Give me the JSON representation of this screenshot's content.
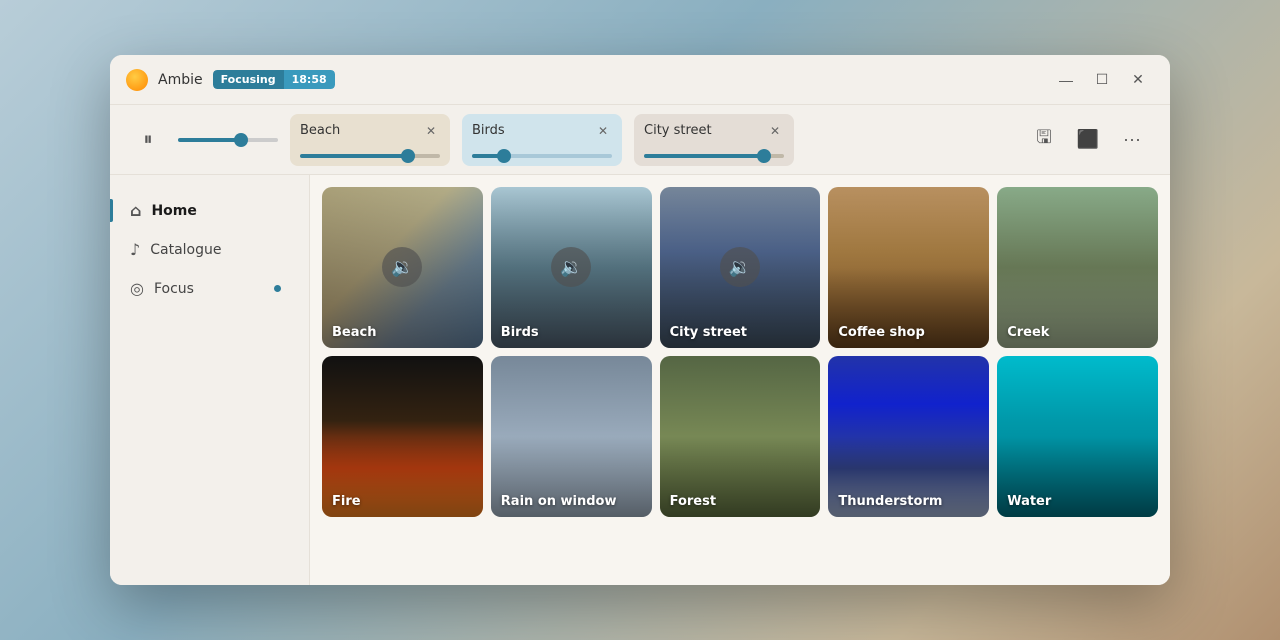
{
  "app": {
    "name": "Ambie",
    "badge_label": "Focusing",
    "badge_time": "18:58"
  },
  "window_controls": {
    "minimize": "—",
    "maximize": "☐",
    "close": "✕"
  },
  "toolbar": {
    "pause_icon": "⏸",
    "save_icon": "💾",
    "image_icon": "🖼",
    "more_icon": "···",
    "tracks": [
      {
        "name": "Beach",
        "value": 80,
        "theme": "beach"
      },
      {
        "name": "Birds",
        "value": 20,
        "theme": "birds"
      },
      {
        "name": "City street",
        "value": 90,
        "theme": "citystreet"
      }
    ]
  },
  "sidebar": {
    "items": [
      {
        "id": "home",
        "label": "Home",
        "icon": "⌂",
        "active": true
      },
      {
        "id": "catalogue",
        "label": "Catalogue",
        "icon": "♪",
        "active": false
      },
      {
        "id": "focus",
        "label": "Focus",
        "icon": "◎",
        "active": false,
        "dot": true
      }
    ]
  },
  "grid": {
    "row1": [
      {
        "id": "beach",
        "label": "Beach",
        "theme": "tile-beach",
        "active": true
      },
      {
        "id": "birds",
        "label": "Birds",
        "theme": "tile-birds",
        "active": true
      },
      {
        "id": "citystreet",
        "label": "City street",
        "theme": "tile-citystreet",
        "active": true
      },
      {
        "id": "coffeeshop",
        "label": "Coffee shop",
        "theme": "tile-coffeeshop",
        "active": false
      },
      {
        "id": "creek",
        "label": "Creek",
        "theme": "tile-creek",
        "active": false
      }
    ],
    "row2": [
      {
        "id": "fire",
        "label": "Fire",
        "theme": "tile-fire",
        "active": false
      },
      {
        "id": "rain",
        "label": "Rain on window",
        "theme": "tile-rain1",
        "active": false
      },
      {
        "id": "forest",
        "label": "Forest",
        "theme": "tile-forest",
        "active": false
      },
      {
        "id": "storm",
        "label": "Thunderstorm",
        "theme": "tile-storm",
        "active": false
      },
      {
        "id": "water",
        "label": "Water",
        "theme": "tile-water",
        "active": false
      }
    ]
  }
}
